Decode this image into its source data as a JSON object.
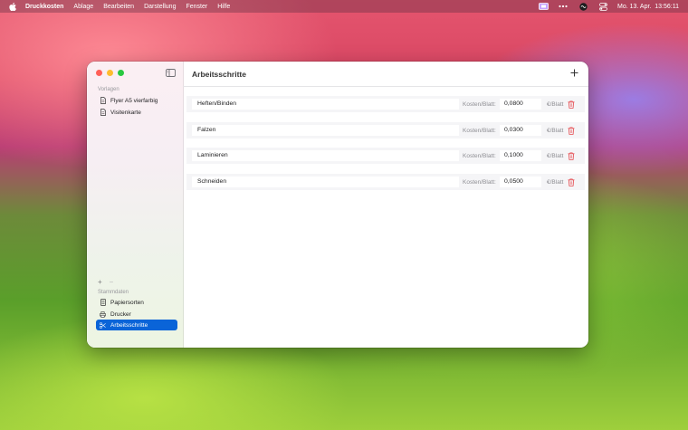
{
  "menubar": {
    "app_name": "Druckkosten",
    "items": [
      "Ablage",
      "Bearbeiten",
      "Darstellung",
      "Fenster",
      "Hilfe"
    ],
    "datetime": "Mo. 13. Apr.  13:56:11"
  },
  "sidebar": {
    "templates_label": "Vorlagen",
    "templates": [
      {
        "label": "Flyer A5 vierfarbig",
        "icon": "document-icon"
      },
      {
        "label": "Visitenkarte",
        "icon": "document-icon"
      }
    ],
    "master_label": "Stammdaten",
    "master": [
      {
        "label": "Papiersorten",
        "icon": "document-lines-icon"
      },
      {
        "label": "Drucker",
        "icon": "printer-icon"
      },
      {
        "label": "Arbeitsschritte",
        "icon": "scissors-icon",
        "selected": true
      }
    ],
    "add_label": "+",
    "remove_label": "−"
  },
  "main": {
    "title": "Arbeitsschritte",
    "add_label": "+",
    "rows": [
      {
        "name": "Heften/Binden",
        "cost_label": "Kosten/Blatt:",
        "value": "0,0800",
        "unit": "€/Blatt"
      },
      {
        "name": "Falzen",
        "cost_label": "Kosten/Blatt:",
        "value": "0,0300",
        "unit": "€/Blatt"
      },
      {
        "name": "Laminieren",
        "cost_label": "Kosten/Blatt:",
        "value": "0,1000",
        "unit": "€/Blatt"
      },
      {
        "name": "Schneiden",
        "cost_label": "Kosten/Blatt:",
        "value": "0,0500",
        "unit": "€/Blatt"
      }
    ]
  },
  "colors": {
    "accent": "#0a64d8",
    "delete": "#e5484d"
  }
}
